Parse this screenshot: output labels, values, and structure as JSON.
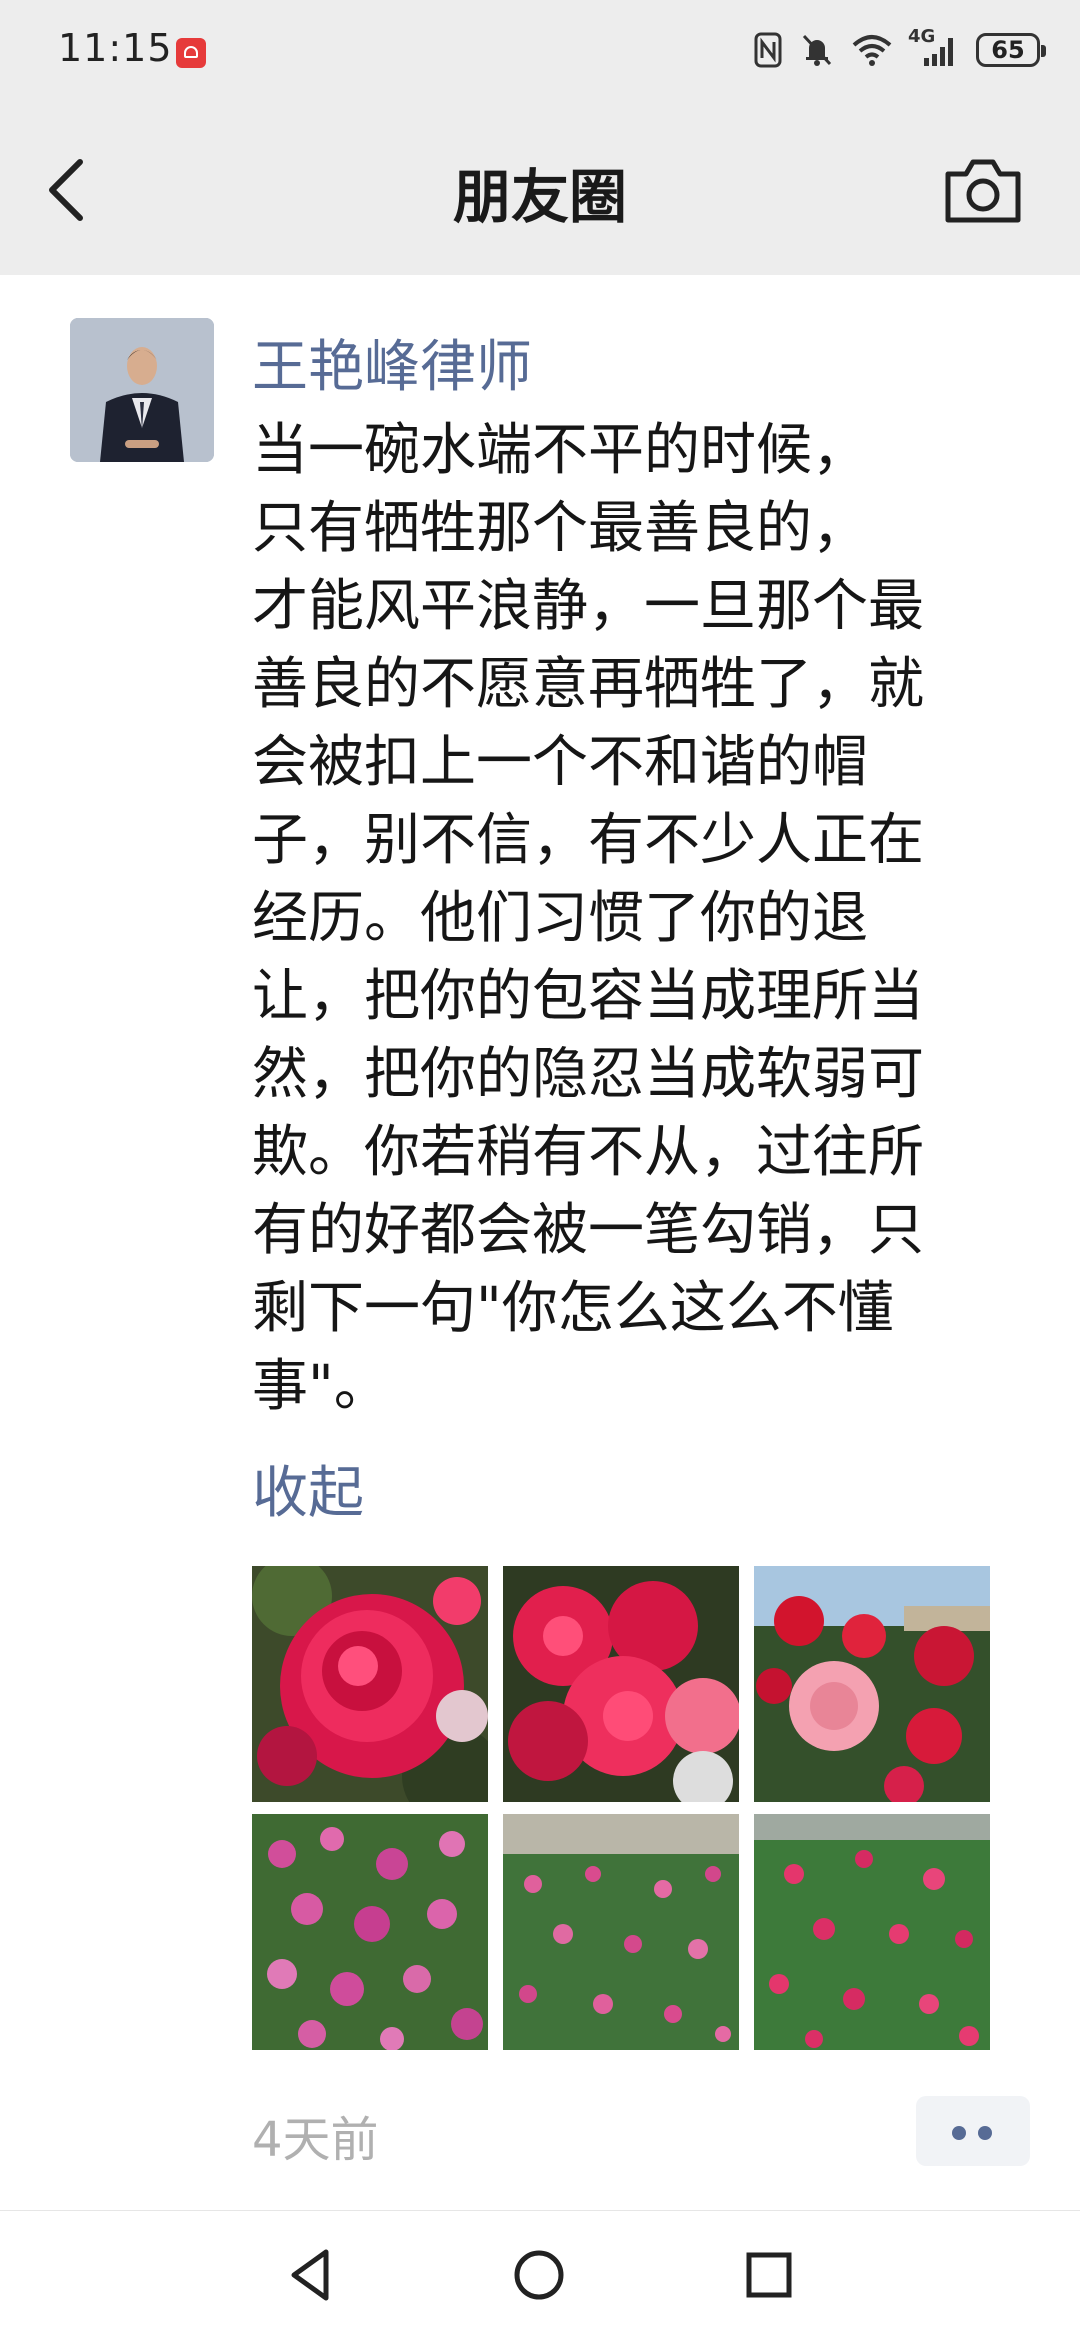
{
  "status_bar": {
    "time": "11:15",
    "network": "4G",
    "battery": "65",
    "icons": [
      "huawei-app-icon",
      "nfc-icon",
      "mute-bell-icon",
      "wifi-icon",
      "signal-icon",
      "battery-icon"
    ]
  },
  "header": {
    "title": "朋友圈",
    "back_icon": "chevron-left-icon",
    "camera_icon": "camera-icon"
  },
  "post": {
    "author": "王艳峰律师",
    "text_lines": [
      "当一碗水端不平的时候，",
      "只有牺牲那个最善良的，",
      "才能风平浪静，一旦那个最",
      "善良的不愿意再牺牲了，就",
      "会被扣上一个不和谐的帽",
      "子，别不信，有不少人正在",
      "经历。他们习惯了你的退",
      "让，把你的包容当成理所当",
      "然，把你的隐忍当成软弱可",
      "欺。你若稍有不从，过往所",
      "有的好都会被一笔勾销，只",
      "剩下一句\"你怎么这么不懂",
      "事\"。"
    ],
    "collapse_label": "收起",
    "photo_count": 6,
    "time_ago": "4天前"
  },
  "colors": {
    "link": "#576b95",
    "header_bg": "#ededed",
    "muted": "#b0b0b0"
  },
  "nav": {
    "icons": [
      "nav-back-icon",
      "nav-home-icon",
      "nav-recents-icon"
    ]
  }
}
